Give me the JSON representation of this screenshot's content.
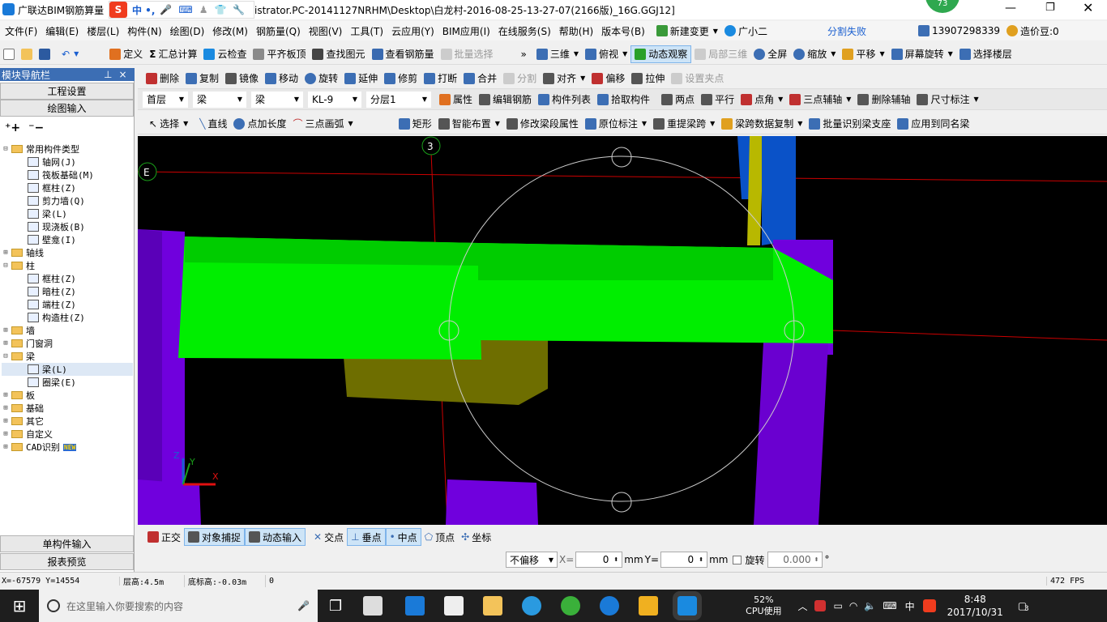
{
  "window": {
    "app_name": "广联达BIM钢筋算量",
    "path": "istrator.PC-20141127NRHM\\Desktop\\白龙村-2016-08-25-13-27-07(2166版)_16G.GGJ12]",
    "badge": "73"
  },
  "ime": {
    "label": "中 •,"
  },
  "menu": [
    "文件(F)",
    "编辑(E)",
    "楼层(L)",
    "构件(N)",
    "绘图(D)",
    "修改(M)",
    "钢筋量(Q)",
    "视图(V)",
    "工具(T)",
    "云应用(Y)",
    "BIM应用(I)",
    "在线服务(S)",
    "帮助(H)",
    "版本号(B)"
  ],
  "menu_right": {
    "new_change": "新建变更",
    "assistant": "广小二",
    "split_fail": "分割失败",
    "phone": "13907298339",
    "price_bean": "造价豆:0"
  },
  "toolbar1": [
    "定义",
    "汇总计算",
    "云检查",
    "平齐板顶",
    "查找图元",
    "查看钢筋量",
    "批量选择"
  ],
  "toolbar1_right": [
    "三维",
    "俯视",
    "动态观察",
    "局部三维",
    "全屏",
    "缩放",
    "平移",
    "屏幕旋转",
    "选择楼层"
  ],
  "toolbar2": [
    "删除",
    "复制",
    "镜像",
    "移动",
    "旋转",
    "延伸",
    "修剪",
    "打断",
    "合并",
    "分割",
    "对齐",
    "偏移",
    "拉伸",
    "设置夹点"
  ],
  "toolbar3": {
    "floor": "首层",
    "type1": "梁",
    "type2": "梁",
    "component": "KL-9",
    "layer": "分层1",
    "items": [
      "属性",
      "编辑钢筋",
      "构件列表",
      "拾取构件",
      "两点",
      "平行",
      "点角",
      "三点辅轴",
      "删除辅轴",
      "尺寸标注"
    ]
  },
  "toolbar4": [
    "选择",
    "直线",
    "点加长度",
    "三点画弧",
    "矩形",
    "智能布置",
    "修改梁段属性",
    "原位标注",
    "重提梁跨",
    "梁跨数据复制",
    "批量识别梁支座",
    "应用到同名梁"
  ],
  "sidebar": {
    "title": "模块导航栏",
    "btn_project": "工程设置",
    "btn_draw": "绘图输入",
    "btn_single": "单构件输入",
    "btn_report": "报表预览",
    "tree": [
      {
        "label": "常用构件类型",
        "level": 0,
        "kind": "folder",
        "exp": "⊟"
      },
      {
        "label": "轴网(J)",
        "level": 1,
        "kind": "leaf"
      },
      {
        "label": "筏板基础(M)",
        "level": 1,
        "kind": "leaf"
      },
      {
        "label": "框柱(Z)",
        "level": 1,
        "kind": "leaf"
      },
      {
        "label": "剪力墙(Q)",
        "level": 1,
        "kind": "leaf"
      },
      {
        "label": "梁(L)",
        "level": 1,
        "kind": "leaf"
      },
      {
        "label": "现浇板(B)",
        "level": 1,
        "kind": "leaf"
      },
      {
        "label": "壁龛(I)",
        "level": 1,
        "kind": "leaf"
      },
      {
        "label": "轴线",
        "level": 0,
        "kind": "folder",
        "exp": "⊞"
      },
      {
        "label": "柱",
        "level": 0,
        "kind": "folder",
        "exp": "⊟"
      },
      {
        "label": "框柱(Z)",
        "level": 1,
        "kind": "leaf"
      },
      {
        "label": "暗柱(Z)",
        "level": 1,
        "kind": "leaf"
      },
      {
        "label": "端柱(Z)",
        "level": 1,
        "kind": "leaf"
      },
      {
        "label": "构造柱(Z)",
        "level": 1,
        "kind": "leaf"
      },
      {
        "label": "墙",
        "level": 0,
        "kind": "folder",
        "exp": "⊞"
      },
      {
        "label": "门窗洞",
        "level": 0,
        "kind": "folder",
        "exp": "⊞"
      },
      {
        "label": "梁",
        "level": 0,
        "kind": "folder",
        "exp": "⊟"
      },
      {
        "label": "梁(L)",
        "level": 1,
        "kind": "leaf",
        "selected": true
      },
      {
        "label": "圈梁(E)",
        "level": 1,
        "kind": "leaf"
      },
      {
        "label": "板",
        "level": 0,
        "kind": "folder",
        "exp": "⊞"
      },
      {
        "label": "基础",
        "level": 0,
        "kind": "folder",
        "exp": "⊞"
      },
      {
        "label": "其它",
        "level": 0,
        "kind": "folder",
        "exp": "⊞"
      },
      {
        "label": "自定义",
        "level": 0,
        "kind": "folder",
        "exp": "⊞"
      },
      {
        "label": "CAD识别",
        "level": 0,
        "kind": "folder",
        "exp": "⊞",
        "tag": "NEW"
      }
    ]
  },
  "viewport": {
    "axis_3": "3",
    "axis_e": "E",
    "gizmo": {
      "x": "X",
      "y": "Y",
      "z": "Z"
    }
  },
  "snapbar": [
    "正交",
    "对象捕捉",
    "动态输入",
    "交点",
    "垂点",
    "中点",
    "顶点",
    "坐标"
  ],
  "coordbar": {
    "offset": "不偏移",
    "x_label": "X=",
    "x_val": "0",
    "unit1": "mm",
    "y_label": "Y=",
    "y_val": "0",
    "unit2": "mm",
    "rotate": "旋转",
    "angle": "0.000",
    "deg": "°"
  },
  "status": {
    "coords": "X=-67579 Y=14554",
    "floor_height": "层高:4.5m",
    "bottom_elev": "底标高:-0.03m",
    "zero": "0",
    "fps": "472 FPS"
  },
  "taskbar": {
    "search_placeholder": "在这里输入你要搜索的内容",
    "cpu_pct": "52%",
    "cpu_label": "CPU使用",
    "ime": "中",
    "time": "8:48",
    "date": "2017/10/31",
    "notif": "3"
  },
  "colors": {
    "beam": "#00ee00",
    "column": "#7000dd",
    "accent": "#3c6eb4",
    "axis_line": "#cc0000"
  }
}
